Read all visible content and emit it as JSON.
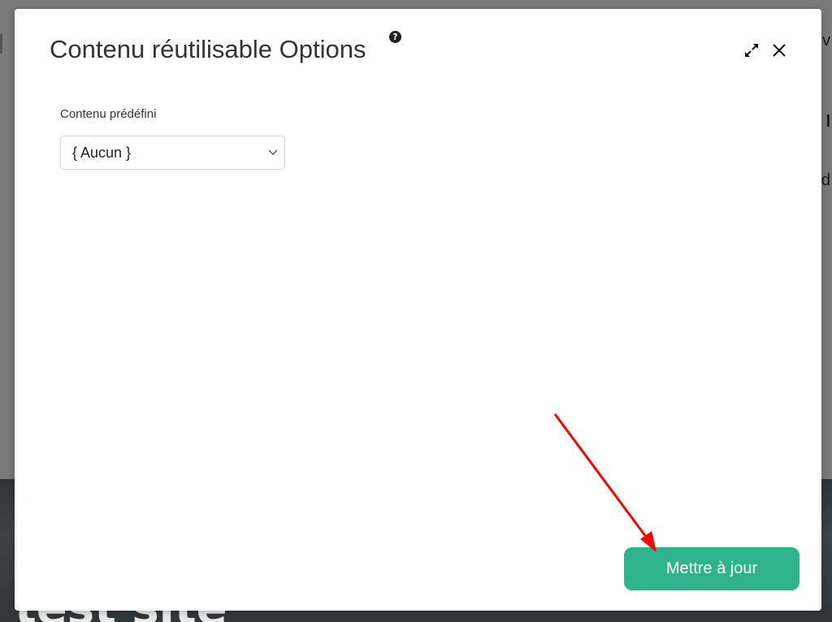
{
  "background": {
    "hero_text": "test site",
    "edge_texts": [
      "v",
      "l",
      "d"
    ]
  },
  "modal": {
    "title": "Contenu réutilisable Options",
    "help_icon": "question-circle-icon",
    "expand_icon": "expand-arrows-icon",
    "close_icon": "close-icon",
    "field": {
      "label": "Contenu prédéfini",
      "selected_value": "{ Aucun }",
      "icon": "chevron-down-icon"
    },
    "update_button_label": "Mettre à jour"
  },
  "colors": {
    "accent": "#2eb38d",
    "annotation": "#ff0000",
    "title": "#333333"
  }
}
